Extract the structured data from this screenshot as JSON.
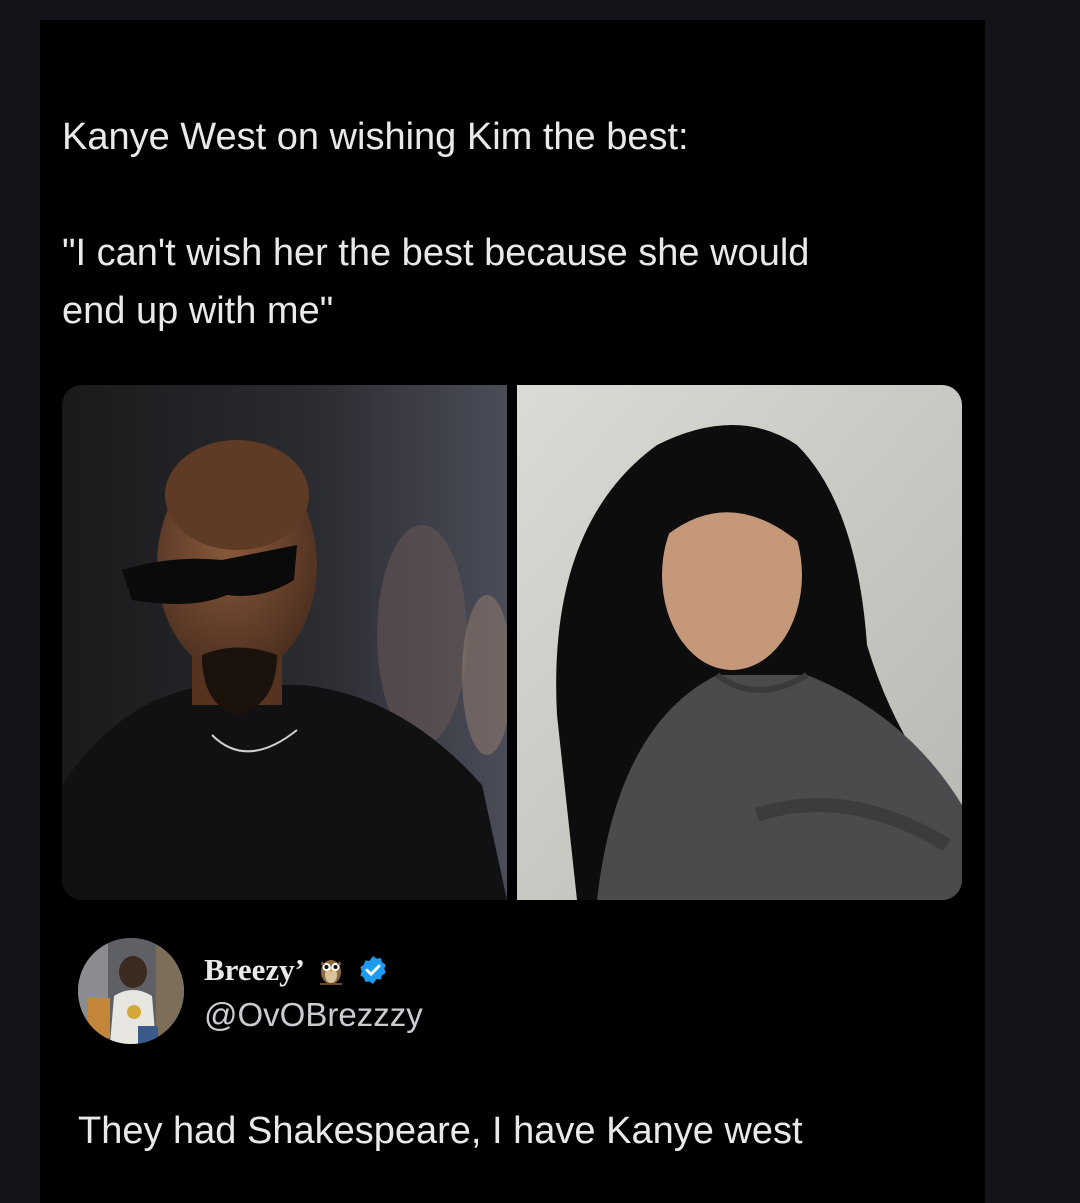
{
  "post": {
    "headline": "Kanye West on wishing Kim the best:",
    "quote_line1": "\"I can't wish her the best because she would",
    "quote_line2": "end up with me\""
  },
  "media": {
    "left_photo": "man-in-sunglasses-photo",
    "right_photo": "woman-long-dark-hair-photo"
  },
  "author": {
    "display_name": "Breezy’",
    "handle": "@OvOBrezzzy",
    "badge_icon": "owl-icon",
    "verified_icon": "verified-badge-icon",
    "verified_color": "#1d9bf0"
  },
  "reply": {
    "text": "They had Shakespeare, I have Kanye west"
  }
}
